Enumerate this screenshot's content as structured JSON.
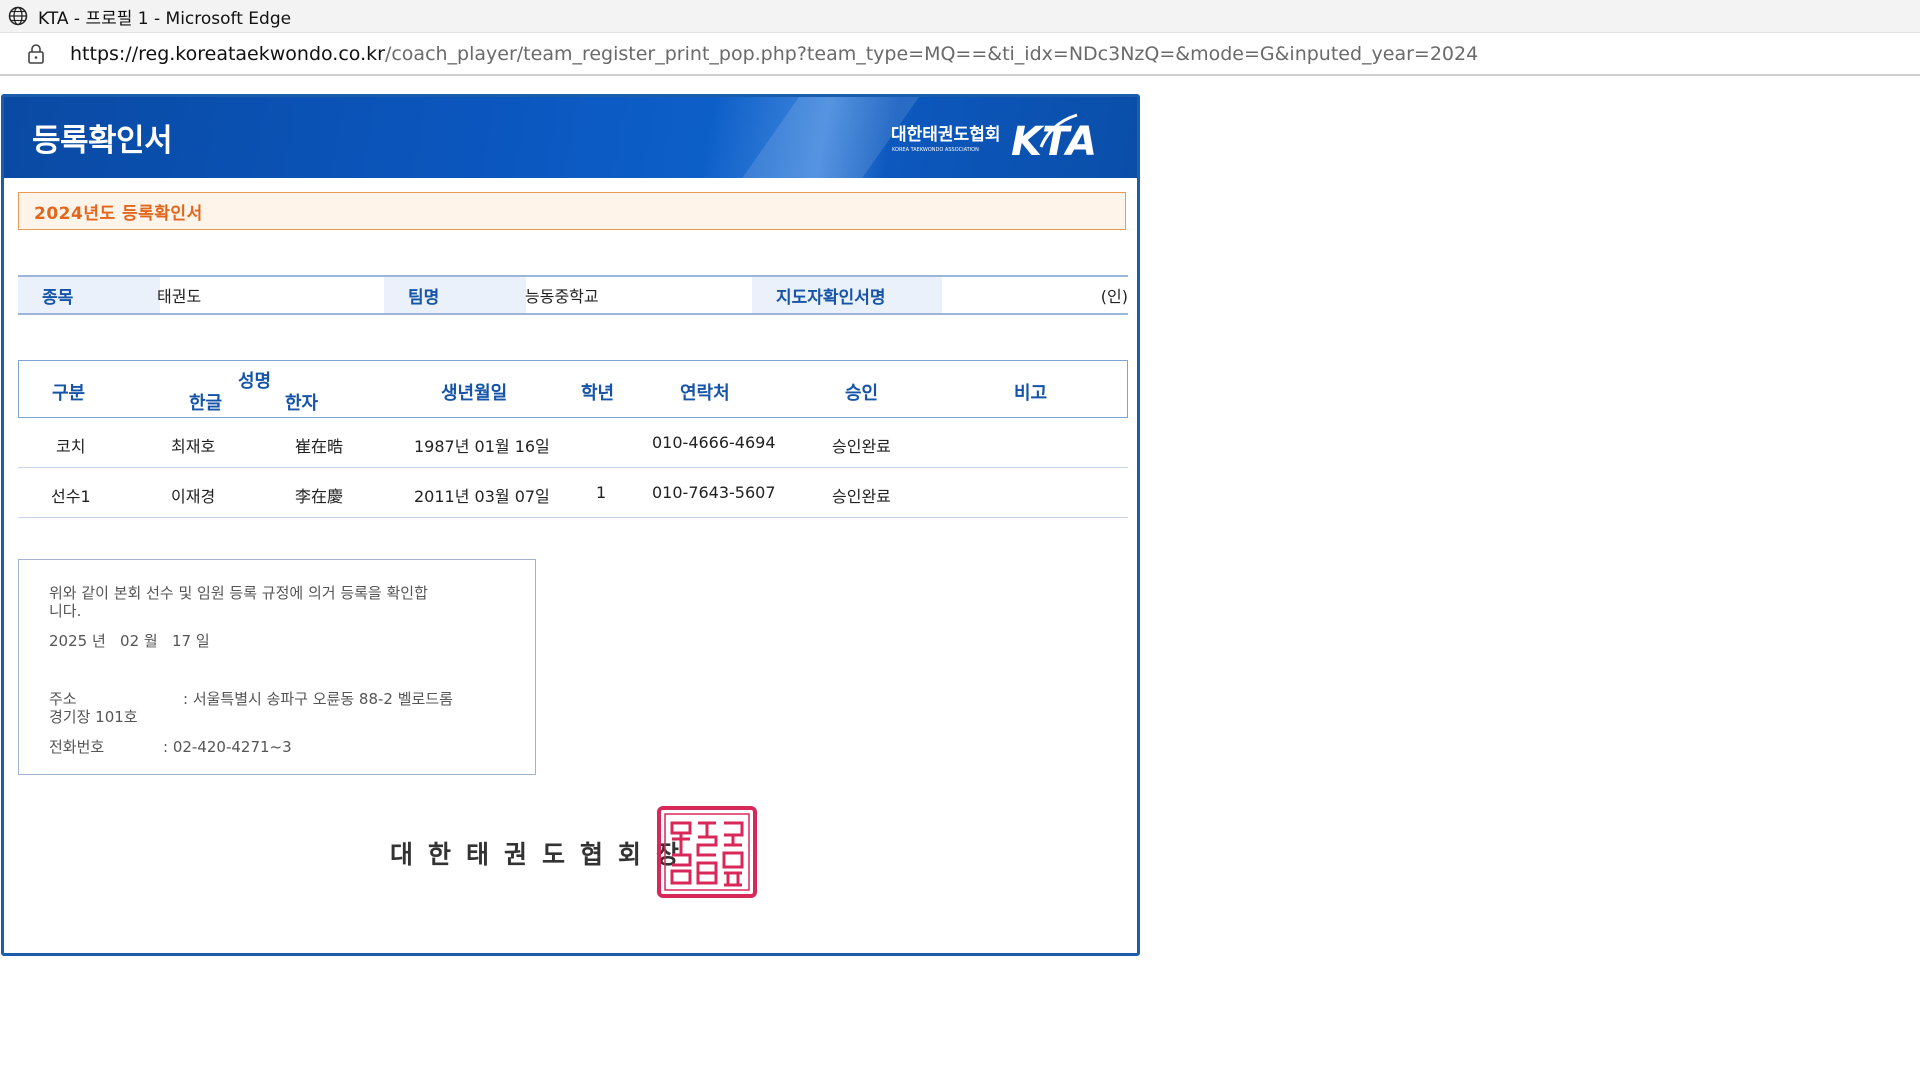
{
  "window": {
    "title": "KTA - 프로필 1 - Microsoft Edge",
    "url_host": "https://reg.koreataekwondo.co.kr",
    "url_path": "/coach_player/team_register_print_pop.php?team_type=MQ==&ti_idx=NDc3NzQ=&mode=G&inputed_year=2024"
  },
  "header": {
    "title": "등록확인서",
    "logo_text_ko": "대한태권도협회",
    "logo_text_en": "KOREA TAEKWONDO ASSOCIATION",
    "logo_mark": "KTA"
  },
  "year_bar": "2024년도 등록확인서",
  "info": {
    "sport_label": "종목",
    "sport_value": "태권도",
    "team_label": "팀명",
    "team_value": "능동중학교",
    "coach_sign_label": "지도자확인서명",
    "seal_mark": "(인)"
  },
  "table": {
    "headers": {
      "division": "구분",
      "name": "성명",
      "name_ko": "한글",
      "name_hanja": "한자",
      "birth": "생년월일",
      "grade": "학년",
      "contact": "연락처",
      "approval": "승인",
      "note": "비고"
    },
    "rows": [
      {
        "division": "코치",
        "name_ko": "최재호",
        "name_hanja": "崔在晧",
        "birth": "1987년 01월 16일",
        "grade": "",
        "contact": "010-4666-4694",
        "approval": "승인완료",
        "note": ""
      },
      {
        "division": "선수1",
        "name_ko": "이재경",
        "name_hanja": "李在慶",
        "birth": "2011년 03월 07일",
        "grade": "1",
        "contact": "010-7643-5607",
        "approval": "승인완료",
        "note": ""
      }
    ]
  },
  "notice": {
    "statement_line1": "위와 같이 본회 선수 및 임원 등록 규정에 의거 등록을 확인합",
    "statement_line2": "니다.",
    "date": "2025 년   02 월   17 일",
    "address_label": "주소",
    "address_value": ": 서울특별시 송파구 오륜동 88-2 벨로드롬",
    "address_value2": "경기장 101호",
    "phone_label": "전화번호",
    "phone_value": ": 02-420-4271~3"
  },
  "issuer": "대한태권도협회장",
  "seal_text": "대한태권도협회장인",
  "colors": {
    "header_blue": "#0b57c0",
    "label_blue": "#1554a8",
    "year_orange": "#e2661c",
    "seal_red": "#d8285a"
  }
}
